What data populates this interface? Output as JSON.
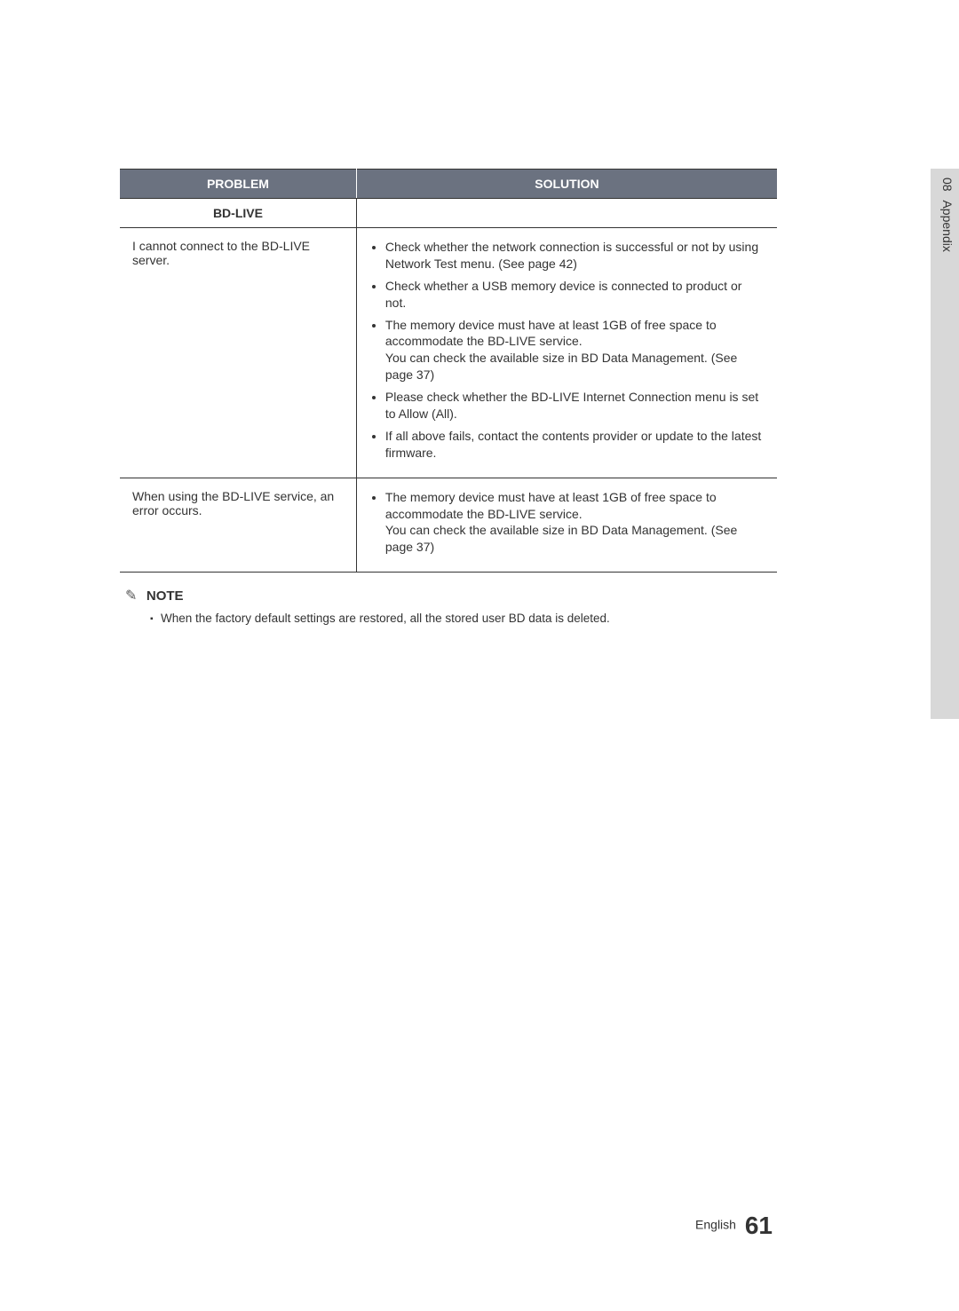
{
  "side": {
    "num": "08",
    "txt": "Appendix"
  },
  "table": {
    "headers": {
      "problem": "PROBLEM",
      "solution": "SOLUTION"
    },
    "subhead": "BD-LIVE",
    "rows": [
      {
        "problem": "I cannot connect to the BD-LIVE server.",
        "solutions": [
          "Check whether the network connection is successful or not by using Network Test menu. (See page 42)",
          "Check whether a USB memory device is connected to product or not.",
          "The memory device must have at least 1GB of free space to accommodate the BD-LIVE service.\nYou can check the available size in BD Data Management. (See page 37)",
          "Please check whether the BD-LIVE Internet Connection menu is set to Allow (All).",
          "If all above fails, contact the contents provider or update to the latest firmware."
        ]
      },
      {
        "problem": "When using the BD-LIVE service, an error occurs.",
        "solutions": [
          "The memory device must have at least 1GB of free space to accommodate the BD-LIVE service.\nYou can check the available size in BD Data Management. (See page 37)"
        ]
      }
    ]
  },
  "note": {
    "title": "NOTE",
    "text": "When the factory default settings are restored, all the stored user BD data is deleted."
  },
  "footer": {
    "lang": "English",
    "page": "61"
  }
}
